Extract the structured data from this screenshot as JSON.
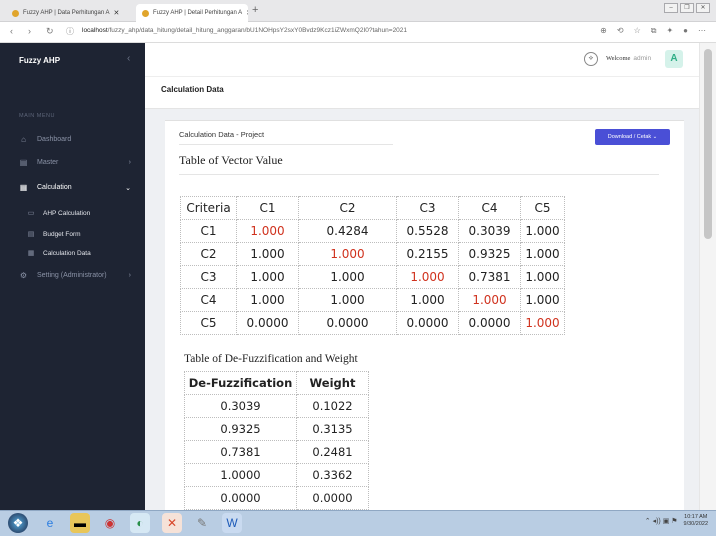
{
  "browser": {
    "tabs": [
      {
        "label": "Fuzzy AHP | Data Perhitungan A"
      },
      {
        "label": "Fuzzy AHP | Detail Perhitungan A"
      }
    ],
    "url_host": "localhost",
    "url_path": "/fuzzy_ahp/data_hitung/detail_hitung_anggaran/bU1NOHpsY2sxY0Bvdz9Kcz1iZWxmQ2I0?tahun=2021"
  },
  "sidebar": {
    "brand": "Fuzzy AHP",
    "menu_header": "MAIN MENU",
    "items": [
      {
        "label": "Dashboard",
        "icon": "home-icon"
      },
      {
        "label": "Master",
        "icon": "folder-icon"
      },
      {
        "label": "Calculation",
        "icon": "calculator-icon"
      },
      {
        "label": "Setting (Administrator)",
        "icon": "gear-icon"
      }
    ],
    "sub_items": [
      {
        "label": "AHP Calculation"
      },
      {
        "label": "Budget Form"
      },
      {
        "label": "Calculation Data"
      }
    ]
  },
  "header": {
    "welcome": "Welcome",
    "user": "admin",
    "avatar_letter": "A"
  },
  "page": {
    "title": "Calculation Data"
  },
  "card": {
    "subtitle": "Calculation Data - Project",
    "download_label": "Download / Cetak ⌄",
    "vector_title": "Table of Vector Value",
    "vector_headers": [
      "Criteria",
      "C1",
      "C2",
      "C3",
      "C4",
      "C5"
    ],
    "vector_rows": [
      [
        "C1",
        "1.000",
        "0.4284",
        "0.5528",
        "0.3039",
        "1.000"
      ],
      [
        "C2",
        "1.000",
        "1.000",
        "0.2155",
        "0.9325",
        "1.000"
      ],
      [
        "C3",
        "1.000",
        "1.000",
        "1.000",
        "0.7381",
        "1.000"
      ],
      [
        "C4",
        "1.000",
        "1.000",
        "1.000",
        "1.000",
        "1.000"
      ],
      [
        "C5",
        "0.0000",
        "0.0000",
        "0.0000",
        "0.0000",
        "1.000"
      ]
    ],
    "defuzz_title": "Table of De-Fuzzification and Weight",
    "defuzz_headers": [
      "De-Fuzzification",
      "Weight"
    ],
    "defuzz_rows": [
      [
        "0.3039",
        "0.1022"
      ],
      [
        "0.9325",
        "0.3135"
      ],
      [
        "0.7381",
        "0.2481"
      ],
      [
        "1.0000",
        "0.3362"
      ],
      [
        "0.0000",
        "0.0000"
      ]
    ],
    "accent_color": "#d0321e"
  },
  "taskbar": {
    "time": "10:17 AM",
    "date": "9/30/2022"
  }
}
